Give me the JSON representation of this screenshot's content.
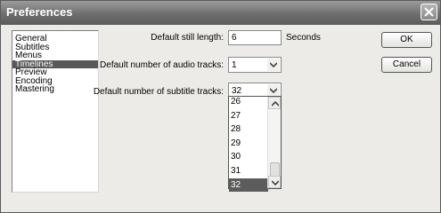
{
  "window": {
    "title": "Preferences",
    "close_icon": "close-icon"
  },
  "sidebar": {
    "items": [
      {
        "label": "General",
        "selected": false
      },
      {
        "label": "Subtitles",
        "selected": false
      },
      {
        "label": "Menus",
        "selected": false
      },
      {
        "label": "Timelines",
        "selected": true
      },
      {
        "label": "Preview",
        "selected": false
      },
      {
        "label": "Encoding",
        "selected": false
      },
      {
        "label": "Mastering",
        "selected": false
      }
    ]
  },
  "settings": {
    "still_length_label": "Default still length:",
    "still_length_value": "6",
    "still_length_unit": "Seconds",
    "audio_tracks_label": "Default number of audio tracks:",
    "audio_tracks_value": "1",
    "subtitle_tracks_label": "Default number of subtitle tracks:",
    "subtitle_tracks_value": "32"
  },
  "subtitle_dropdown": {
    "options": [
      "26",
      "27",
      "28",
      "29",
      "30",
      "31",
      "32"
    ],
    "selected": "32"
  },
  "buttons": {
    "ok": "OK",
    "cancel": "Cancel"
  }
}
